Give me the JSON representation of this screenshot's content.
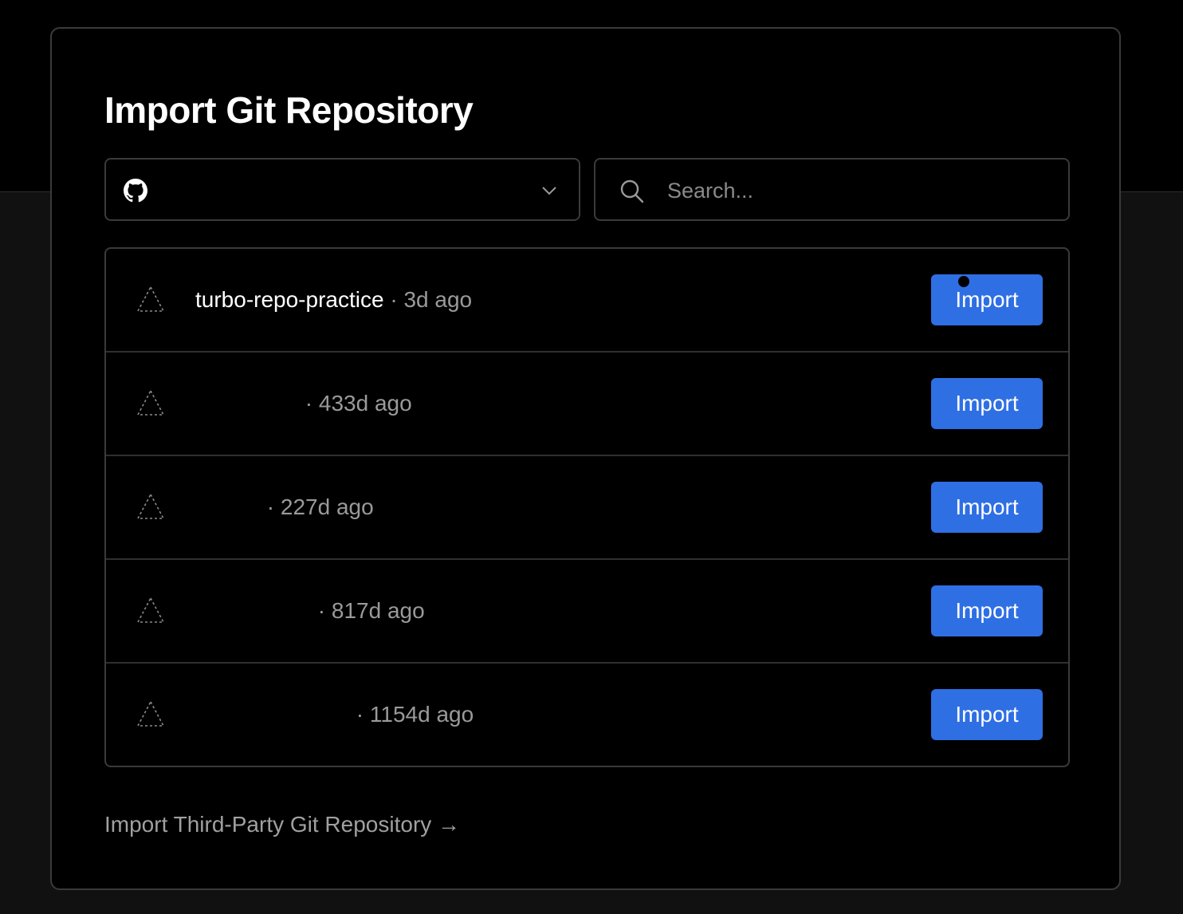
{
  "modal": {
    "title": "Import Git Repository",
    "scope_select": {
      "value": "",
      "icon": "github-icon"
    },
    "search": {
      "placeholder": "Search...",
      "value": ""
    },
    "repos": [
      {
        "name": "turbo-repo-practice",
        "separator": "·",
        "age": "3d ago",
        "import_label": "Import"
      },
      {
        "name": "",
        "separator": "·",
        "age": "433d ago",
        "import_label": "Import"
      },
      {
        "name": "",
        "separator": "·",
        "age": "227d ago",
        "import_label": "Import"
      },
      {
        "name": "",
        "separator": "·",
        "age": "817d ago",
        "import_label": "Import"
      },
      {
        "name": "",
        "separator": "·",
        "age": "1154d ago",
        "import_label": "Import"
      }
    ],
    "third_party_link": "Import Third-Party Git Repository →"
  },
  "colors": {
    "page_background": "#111111",
    "card_background": "#000000",
    "border": "#3a3a3a",
    "primary_button": "#2f6fe4",
    "muted_text": "#9a9a9a"
  }
}
